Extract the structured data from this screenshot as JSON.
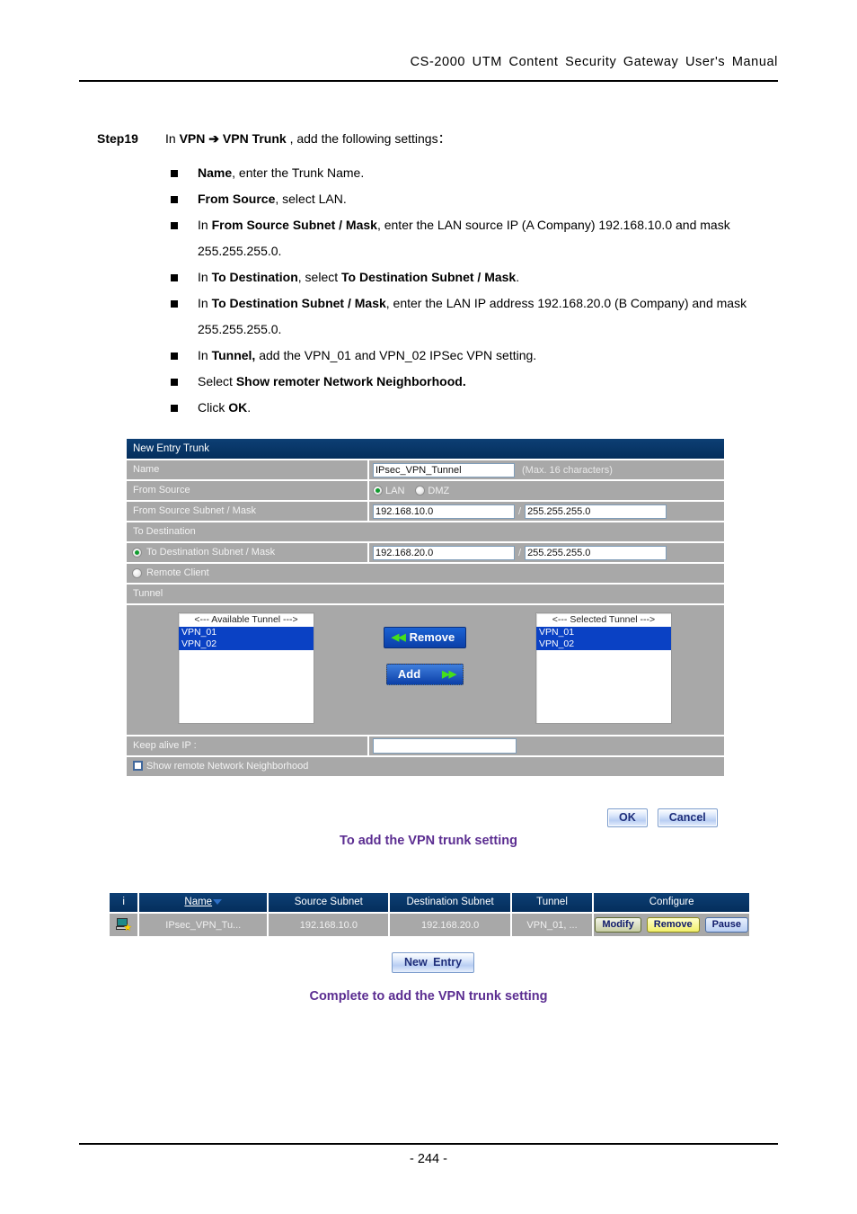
{
  "header": {
    "title": "CS-2000  UTM  Content  Security  Gateway  User's  Manual"
  },
  "step": {
    "label": "Step19",
    "text_prefix": "In ",
    "bold1": "VPN",
    "arrow": " ➔ ",
    "bold2": "VPN Trunk",
    "text_suffix": " , add the following settings："
  },
  "bullets": [
    {
      "parts": [
        {
          "t": "Name",
          "b": true
        },
        {
          "t": ", enter the Trunk Name.",
          "b": false
        }
      ]
    },
    {
      "parts": [
        {
          "t": "From Source",
          "b": true
        },
        {
          "t": ", select LAN.",
          "b": false
        }
      ]
    },
    {
      "parts": [
        {
          "t": "In ",
          "b": false
        },
        {
          "t": "From Source Subnet / Mask",
          "b": true
        },
        {
          "t": ", enter the LAN source IP (A Company) 192.168.10.0 and mask 255.255.255.0.",
          "b": false
        }
      ]
    },
    {
      "parts": [
        {
          "t": "In ",
          "b": false
        },
        {
          "t": "To Destination",
          "b": true
        },
        {
          "t": ", select ",
          "b": false
        },
        {
          "t": "To Destination Subnet / Mask",
          "b": true
        },
        {
          "t": ".",
          "b": false
        }
      ]
    },
    {
      "parts": [
        {
          "t": "In ",
          "b": false
        },
        {
          "t": "To Destination Subnet / Mask",
          "b": true
        },
        {
          "t": ", enter the LAN IP address 192.168.20.0 (B Company) and mask 255.255.255.0.",
          "b": false
        }
      ]
    },
    {
      "parts": [
        {
          "t": "In ",
          "b": false
        },
        {
          "t": "Tunnel,",
          "b": true
        },
        {
          "t": " add the VPN_01 and VPN_02 IPSec VPN setting.",
          "b": false
        }
      ]
    },
    {
      "parts": [
        {
          "t": "Select ",
          "b": false
        },
        {
          "t": "Show remoter Network Neighborhood.",
          "b": true
        }
      ]
    },
    {
      "parts": [
        {
          "t": "Click ",
          "b": false
        },
        {
          "t": "OK",
          "b": true
        },
        {
          "t": ".",
          "b": false
        }
      ]
    }
  ],
  "dialog": {
    "title": "New Entry Trunk",
    "name_label": "Name",
    "name_value": "IPsec_VPN_Tunnel",
    "name_hint": "(Max. 16 characters)",
    "from_source_label": "From Source",
    "from_source_options": [
      {
        "label": "LAN",
        "selected": true
      },
      {
        "label": "DMZ",
        "selected": false
      }
    ],
    "from_subnet_label": "From Source Subnet / Mask",
    "from_subnet_ip": "192.168.10.0",
    "from_subnet_mask": "255.255.255.0",
    "to_destination_label": "To Destination",
    "to_dest_subnet_label": "To Destination Subnet / Mask",
    "to_dest_subnet_selected": true,
    "to_dest_ip": "192.168.20.0",
    "to_dest_mask": "255.255.255.0",
    "remote_client_label": "Remote Client",
    "remote_client_selected": false,
    "tunnel_label": "Tunnel",
    "available_header": "<--- Available Tunnel --->",
    "available_items": [
      "VPN_01",
      "VPN_02"
    ],
    "selected_header": "<--- Selected Tunnel --->",
    "selected_items": [
      "VPN_01",
      "VPN_02"
    ],
    "remove_button": "Remove",
    "remove_arrows": "◀◀",
    "add_button": "Add",
    "add_arrows": "▶▶",
    "keepalive_label": "Keep alive IP :",
    "keepalive_value": "",
    "show_remote_label": "Show remote Network Neighborhood",
    "show_remote_checked": false,
    "ok_button": "OK",
    "cancel_button": "Cancel"
  },
  "captions": {
    "figure1": "To add the VPN trunk setting",
    "figure2": "Complete to add the VPN trunk setting"
  },
  "table": {
    "headers": [
      "i",
      "Name",
      "Source Subnet",
      "Destination Subnet",
      "Tunnel",
      "Configure"
    ],
    "sort_column": "Name",
    "rows": [
      {
        "icon": "computer-star-icon",
        "name": "IPsec_VPN_Tu...",
        "source_subnet": "192.168.10.0",
        "destination_subnet": "192.168.20.0",
        "tunnel": "VPN_01, ...",
        "actions": [
          "Modify",
          "Remove",
          "Pause"
        ]
      }
    ]
  },
  "new_entry_button": "New  Entry",
  "footer": {
    "page_number": "- 244 -"
  },
  "colors": {
    "dialog_header": "#0a3a70",
    "dialog_row": "#a8a8a8",
    "caption_purple": "#5b2d91",
    "list_selection": "#0a41c4",
    "button_blue": "#0b3fa8"
  }
}
